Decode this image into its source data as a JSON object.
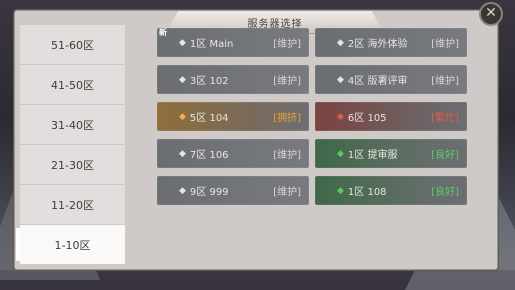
{
  "title": "服务器选择",
  "sidebar": {
    "items": [
      {
        "label": "51-60区",
        "active": false
      },
      {
        "label": "41-50区",
        "active": false
      },
      {
        "label": "31-40区",
        "active": false
      },
      {
        "label": "21-30区",
        "active": false
      },
      {
        "label": "11-20区",
        "active": false
      },
      {
        "label": "1-10区",
        "active": true
      }
    ]
  },
  "servers": [
    {
      "name": "1区 Main",
      "status": "[维护]",
      "tone": "grey",
      "tag": "新"
    },
    {
      "name": "2区 海外体验",
      "status": "[维护]",
      "tone": "grey",
      "tag": ""
    },
    {
      "name": "3区 102",
      "status": "[维护]",
      "tone": "grey",
      "tag": ""
    },
    {
      "name": "4区 版署评审",
      "status": "[维护]",
      "tone": "grey",
      "tag": ""
    },
    {
      "name": "5区 104",
      "status": "[拥挤]",
      "tone": "orange",
      "tag": ""
    },
    {
      "name": "6区 105",
      "status": "[繁忙]",
      "tone": "red",
      "tag": ""
    },
    {
      "name": "7区 106",
      "status": "[维护]",
      "tone": "grey",
      "tag": ""
    },
    {
      "name": "1区 提审服",
      "status": "[良好]",
      "tone": "green",
      "tag": ""
    },
    {
      "name": "9区 999",
      "status": "[维护]",
      "tone": "grey",
      "tag": ""
    },
    {
      "name": "1区 108",
      "status": "[良好]",
      "tone": "green",
      "tag": ""
    }
  ],
  "icons": {
    "close": "close-icon",
    "server_marker": "diamond-icon"
  },
  "colors": {
    "status_grey": "#d6d6d6",
    "status_orange": "#e6a23c",
    "status_red": "#e05a4c",
    "status_green": "#5ccc6a"
  }
}
